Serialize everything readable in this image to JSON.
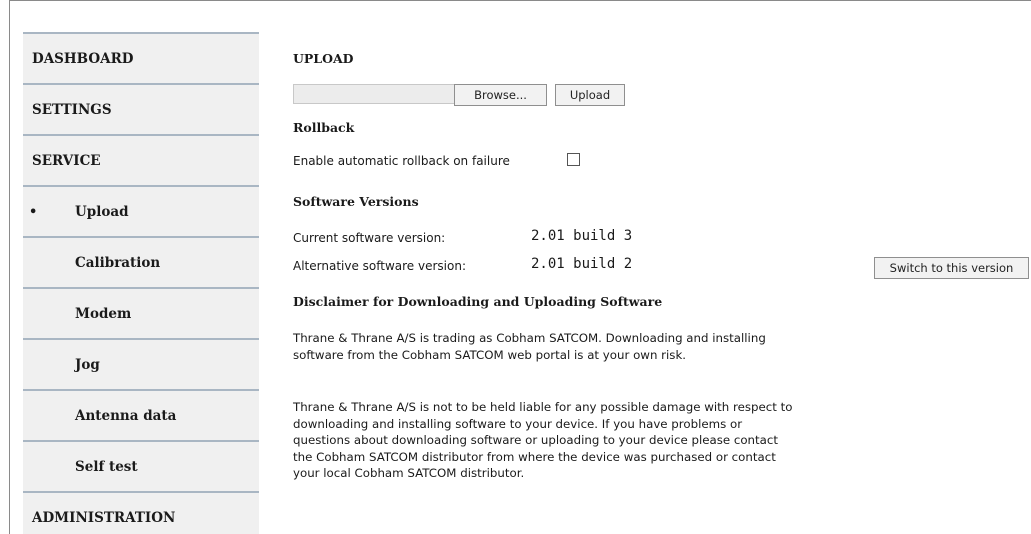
{
  "sidebar": {
    "items": [
      {
        "label": "DASHBOARD",
        "level": "top",
        "active": false
      },
      {
        "label": "SETTINGS",
        "level": "top",
        "active": false
      },
      {
        "label": "SERVICE",
        "level": "top",
        "active": false
      },
      {
        "label": "Upload",
        "level": "sub",
        "active": true
      },
      {
        "label": "Calibration",
        "level": "sub",
        "active": false
      },
      {
        "label": "Modem",
        "level": "sub",
        "active": false
      },
      {
        "label": "Jog",
        "level": "sub",
        "active": false
      },
      {
        "label": "Antenna data",
        "level": "sub",
        "active": false
      },
      {
        "label": "Self test",
        "level": "sub",
        "active": false
      },
      {
        "label": "ADMINISTRATION",
        "level": "top",
        "active": false
      }
    ],
    "bullet": "•"
  },
  "upload": {
    "heading": "UPLOAD",
    "browse_label": "Browse...",
    "upload_label": "Upload"
  },
  "rollback": {
    "heading": "Rollback",
    "checkbox_label": "Enable automatic rollback on failure",
    "checked": false
  },
  "versions": {
    "heading": "Software Versions",
    "current_label": "Current software version:",
    "current_value": "2.01 build 3",
    "alternative_label": "Alternative software version:",
    "alternative_value": "2.01 build 2",
    "switch_label": "Switch to this version"
  },
  "disclaimer": {
    "heading": "Disclaimer for Downloading and Uploading Software",
    "para1": "Thrane & Thrane A/S is trading as Cobham SATCOM. Downloading and installing software from the Cobham SATCOM web portal is at your own risk.",
    "para2": "Thrane & Thrane A/S is not to be held liable for any possible damage with respect to downloading and installing software to your device. If you have problems or questions about downloading software or uploading to your device please contact the Cobham SATCOM distributor from where the device was purchased or contact your local Cobham SATCOM distributor."
  }
}
